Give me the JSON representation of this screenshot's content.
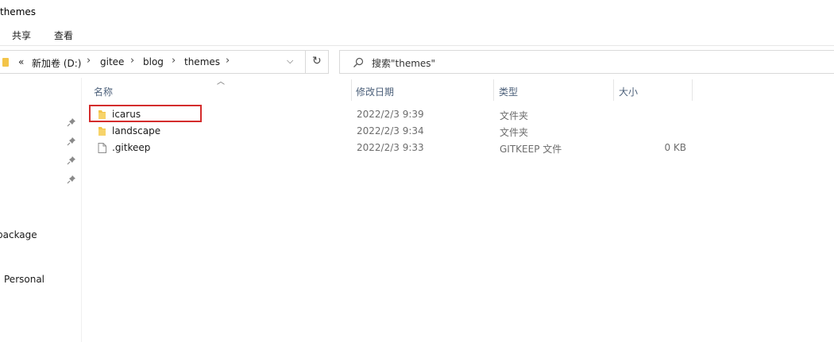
{
  "window": {
    "title": "themes"
  },
  "ribbon": {
    "tabs": [
      "共享",
      "查看"
    ]
  },
  "address": {
    "overflow": "«",
    "crumbs": [
      "新加卷 (D:)",
      "gitee",
      "blog",
      "themes"
    ],
    "dropdown_icon": "chevron-down-icon",
    "refresh_icon": "refresh-icon"
  },
  "search": {
    "placeholder": "搜索\"themes\""
  },
  "navpane": {
    "items": [
      "package",
      "Personal"
    ]
  },
  "columns": {
    "name": "名称",
    "modified": "修改日期",
    "type": "类型",
    "size": "大小"
  },
  "files": [
    {
      "name": "icarus",
      "modified": "2022/2/3 9:39",
      "type": "文件夹",
      "size": "",
      "icon": "folder-icon",
      "selected": true
    },
    {
      "name": "landscape",
      "modified": "2022/2/3 9:34",
      "type": "文件夹",
      "size": "",
      "icon": "folder-icon"
    },
    {
      "name": ".gitkeep",
      "modified": "2022/2/3 9:33",
      "type": "GITKEEP 文件",
      "size": "0 KB",
      "icon": "file-icon"
    }
  ],
  "colors": {
    "folder": "#f3c449",
    "highlight_border": "#d42c2c",
    "header_text": "#4c607a"
  }
}
